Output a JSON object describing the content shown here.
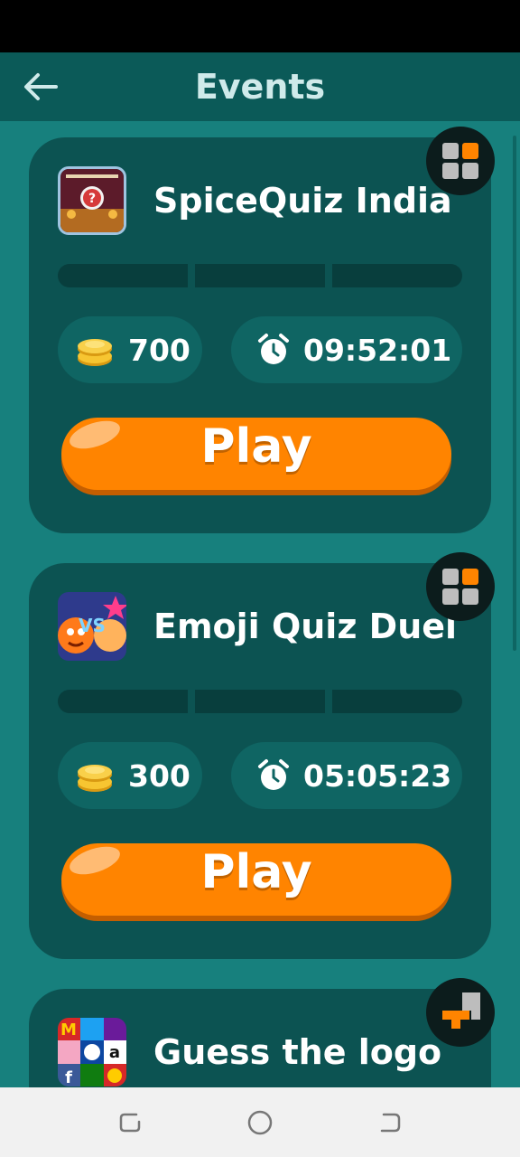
{
  "header": {
    "title": "Events",
    "back_icon": "arrow-left-icon"
  },
  "events": [
    {
      "title": "SpiceQuiz India",
      "icon": "spicequiz-app-icon",
      "coins": "700",
      "timer": "09:52:01",
      "play_label": "Play",
      "badge_icon": "grid-squares-icon"
    },
    {
      "title": "Emoji Quiz Duel",
      "icon": "emoji-quiz-duel-app-icon",
      "coins": "300",
      "timer": "05:05:23",
      "play_label": "Play",
      "badge_icon": "grid-squares-icon"
    },
    {
      "title": "Guess the logo",
      "icon": "guess-the-logo-app-icon",
      "badge_icon": "block-puzzle-icon"
    }
  ],
  "nav": {
    "recent_icon": "recent-apps-icon",
    "home_icon": "home-icon",
    "back_icon": "back-icon"
  },
  "colors": {
    "background": "#17807d",
    "card": "#0c5352",
    "accent": "#ff8400",
    "header": "#0b5a58"
  }
}
